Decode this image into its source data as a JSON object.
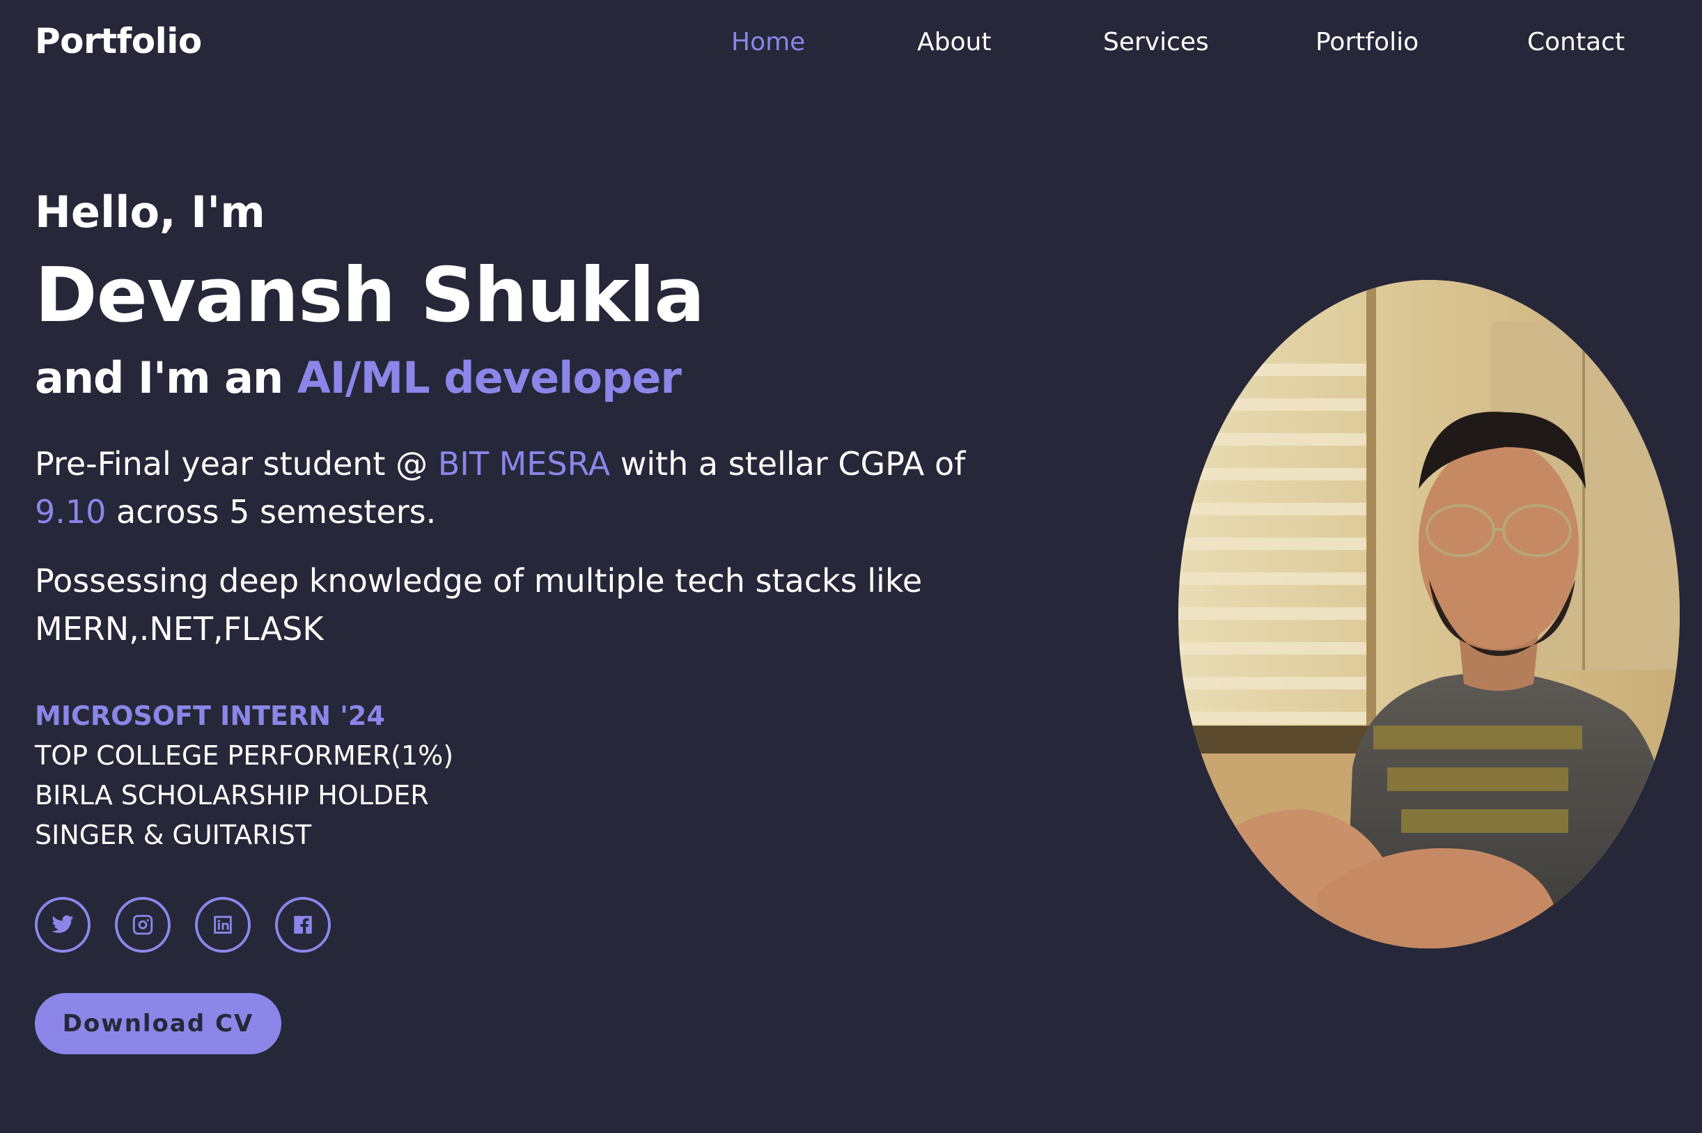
{
  "brand": {
    "logo": "Portfolio"
  },
  "nav": {
    "items": [
      {
        "label": "Home",
        "active": true
      },
      {
        "label": "About",
        "active": false
      },
      {
        "label": "Services",
        "active": false
      },
      {
        "label": "Portfolio",
        "active": false
      },
      {
        "label": "Contact",
        "active": false
      }
    ]
  },
  "hero": {
    "greeting": "Hello, I'm",
    "name": "Devansh Shukla",
    "role_prefix": "and I'm an ",
    "role": "AI/ML developer",
    "bio1": {
      "part1": "Pre-Final year student @ ",
      "college": "BIT MESRA",
      "part2": " with a stellar CGPA of ",
      "cgpa": "9.10",
      "part3": " across 5 semesters."
    },
    "bio2": "Possessing deep knowledge of multiple tech stacks like MERN,.NET,FLASK",
    "achievements": [
      "MICROSOFT INTERN '24",
      "TOP COLLEGE PERFORMER(1%)",
      "BIRLA SCHOLARSHIP HOLDER",
      "SINGER & GUITARIST"
    ],
    "socials": [
      "twitter-icon",
      "instagram-icon",
      "linkedin-icon",
      "facebook-icon"
    ],
    "download_label": "Download CV"
  },
  "colors": {
    "background": "#262739",
    "accent": "#8b86e8",
    "text": "#ffffff"
  }
}
